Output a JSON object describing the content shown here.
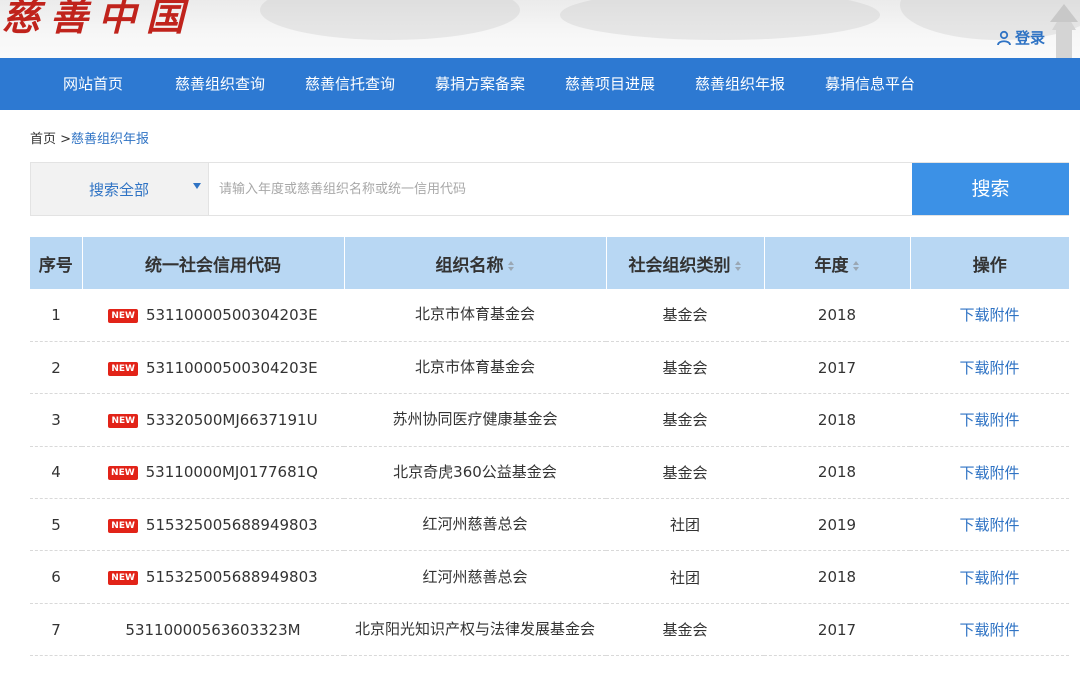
{
  "header": {
    "logo_text": "慈善中国",
    "login_label": "登录"
  },
  "nav": {
    "items": [
      "网站首页",
      "慈善组织查询",
      "慈善信托查询",
      "募捐方案备案",
      "慈善项目进展",
      "慈善组织年报",
      "募捐信息平台"
    ]
  },
  "breadcrumb": {
    "home": "首页 >",
    "current": "慈善组织年报"
  },
  "search": {
    "scope_label": "搜索全部",
    "placeholder": "请输入年度或慈善组织名称或统一信用代码",
    "value": "",
    "button_label": "搜索"
  },
  "table": {
    "columns": [
      "序号",
      "统一社会信用代码",
      "组织名称",
      "社会组织类别",
      "年度",
      "操作"
    ],
    "new_badge": "NEW",
    "rows": [
      {
        "index": "1",
        "code": "53110000500304203E",
        "name": "北京市体育基金会",
        "type": "基金会",
        "year": "2018",
        "action": "下载附件",
        "is_new": true
      },
      {
        "index": "2",
        "code": "53110000500304203E",
        "name": "北京市体育基金会",
        "type": "基金会",
        "year": "2017",
        "action": "下载附件",
        "is_new": true
      },
      {
        "index": "3",
        "code": "53320500MJ6637191U",
        "name": "苏州协同医疗健康基金会",
        "type": "基金会",
        "year": "2018",
        "action": "下载附件",
        "is_new": true
      },
      {
        "index": "4",
        "code": "53110000MJ0177681Q",
        "name": "北京奇虎360公益基金会",
        "type": "基金会",
        "year": "2018",
        "action": "下载附件",
        "is_new": true
      },
      {
        "index": "5",
        "code": "515325005688949803",
        "name": "红河州慈善总会",
        "type": "社团",
        "year": "2019",
        "action": "下载附件",
        "is_new": true
      },
      {
        "index": "6",
        "code": "515325005688949803",
        "name": "红河州慈善总会",
        "type": "社团",
        "year": "2018",
        "action": "下载附件",
        "is_new": true
      },
      {
        "index": "7",
        "code": "53110000563603323M",
        "name": "北京阳光知识产权与法律发展基金会",
        "type": "基金会",
        "year": "2017",
        "action": "下载附件",
        "is_new": false
      }
    ]
  },
  "colors": {
    "nav_bg": "#2d79d2",
    "header_bg": "#b8d7f3",
    "link": "#2f73c4",
    "badge": "#e22318",
    "search_button": "#3c91e6"
  }
}
